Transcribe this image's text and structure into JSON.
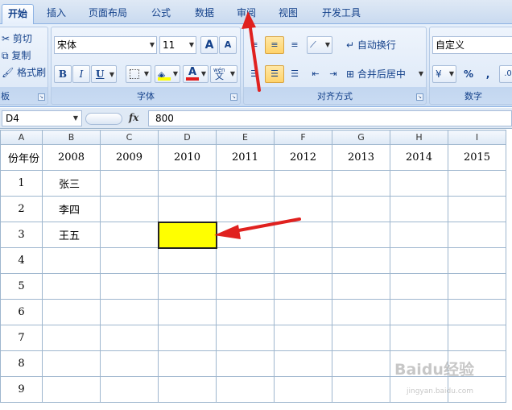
{
  "tabs": [
    {
      "label": "开始",
      "active": true
    },
    {
      "label": "插入"
    },
    {
      "label": "页面布局"
    },
    {
      "label": "公式"
    },
    {
      "label": "数据"
    },
    {
      "label": "审阅"
    },
    {
      "label": "视图"
    },
    {
      "label": "开发工具"
    }
  ],
  "clipboard": {
    "cut": "剪切",
    "copy": "复制",
    "format_painter": "格式刷",
    "label": "板"
  },
  "font": {
    "name": "宋体",
    "size": "11",
    "grow": "A",
    "shrink": "A",
    "bold": "B",
    "italic": "I",
    "underline": "U",
    "fill_color": "#ffff00",
    "font_color": "#e31c1c",
    "phonetic": "wén",
    "phonetic_char": "文",
    "label": "字体"
  },
  "alignment": {
    "wrap_text": "自动换行",
    "merge_center": "合并后居中",
    "label": "对齐方式"
  },
  "number": {
    "format": "自定义",
    "percent": "%",
    "comma": ",",
    "label": "数字"
  },
  "formula_bar": {
    "name_box": "D4",
    "fx": "fx",
    "value": "800"
  },
  "sheet": {
    "columns": [
      "A",
      "B",
      "C",
      "D",
      "E",
      "F",
      "G",
      "H",
      "I"
    ],
    "header_row": {
      "a": "份年份",
      "years": [
        "2008",
        "2009",
        "2010",
        "2011",
        "2012",
        "2013",
        "2014",
        "2015"
      ]
    },
    "rows": [
      {
        "num": "1",
        "b": "张三"
      },
      {
        "num": "2",
        "b": "李四"
      },
      {
        "num": "3",
        "b": "王五"
      },
      {
        "num": "4",
        "b": ""
      },
      {
        "num": "5",
        "b": ""
      },
      {
        "num": "6",
        "b": ""
      },
      {
        "num": "7",
        "b": ""
      },
      {
        "num": "8",
        "b": ""
      },
      {
        "num": "9",
        "b": ""
      }
    ],
    "selected_cell": "D4"
  },
  "watermark": {
    "text": "Baidu经验",
    "sub": "jingyan.baidu.com"
  },
  "colors": {
    "selected_fill": "#ffff00",
    "arrow": "#e0211f"
  }
}
